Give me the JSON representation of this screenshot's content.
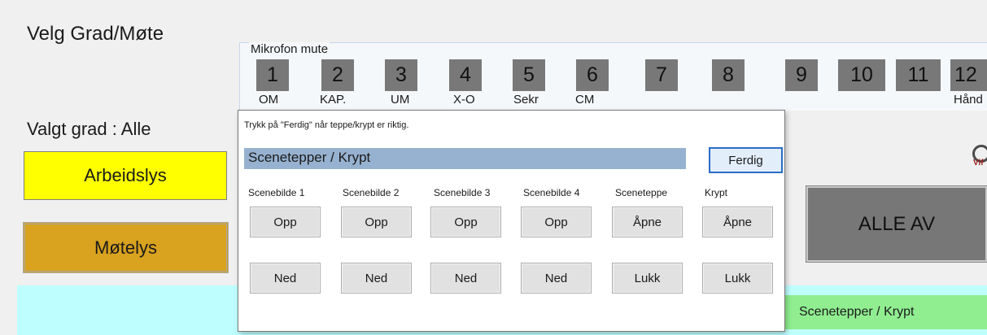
{
  "main": {
    "title": "Velg Grad/Møte",
    "selected_grade": "Valgt grad : Alle",
    "buttons": {
      "arbeidslys": "Arbeidslys",
      "motelys": "Møtelys",
      "alle_av": "ALLE AV"
    },
    "bottom_tab": "Scenetepper / Krypt",
    "logo_text": "Vif"
  },
  "mic": {
    "label": "Mikrofon mute",
    "buttons": [
      "1",
      "2",
      "3",
      "4",
      "5",
      "6",
      "7",
      "8",
      "9",
      "10",
      "11",
      "12"
    ],
    "captions": [
      "OM",
      "KAP.",
      "UM",
      "X-O",
      "Sekr",
      "CM",
      "Hånd"
    ]
  },
  "dialog": {
    "instruction": "Trykk på \"Ferdig\" når teppe/krypt er  riktig.",
    "header": "Scenetepper / Krypt",
    "done_label": "Ferdig",
    "columns": [
      {
        "label": "Scenebilde 1",
        "top": "Opp",
        "bottom": "Ned"
      },
      {
        "label": "Scenebilde 2",
        "top": "Opp",
        "bottom": "Ned"
      },
      {
        "label": "Scenebilde 3",
        "top": "Opp",
        "bottom": "Ned"
      },
      {
        "label": "Scenebilde 4",
        "top": "Opp",
        "bottom": "Ned"
      },
      {
        "label": "Sceneteppe",
        "top": "Åpne",
        "bottom": "Lukk"
      },
      {
        "label": "Krypt",
        "top": "Åpne",
        "bottom": "Lukk"
      }
    ]
  }
}
